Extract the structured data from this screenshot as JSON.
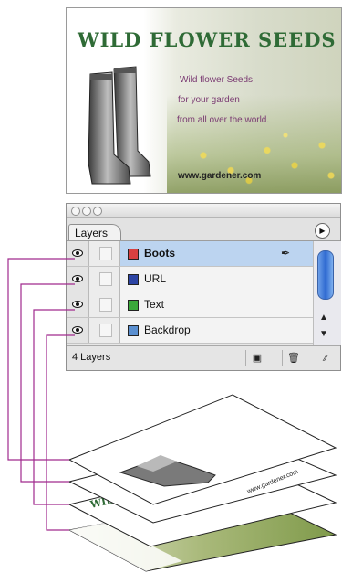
{
  "postcard": {
    "title": "WILD FLOWER SEEDS",
    "tagline": [
      "Wild flower Seeds",
      "for your garden",
      "from all over the world."
    ],
    "url": "www.gardener.com"
  },
  "panel": {
    "tab_label": "Layers",
    "menu_icon": "right-arrow-icon",
    "layers": [
      {
        "name": "Boots",
        "color": "#d84040",
        "selected": true
      },
      {
        "name": "URL",
        "color": "#2c44a4",
        "selected": false
      },
      {
        "name": "Text",
        "color": "#3aa83a",
        "selected": false
      },
      {
        "name": "Backdrop",
        "color": "#5a8fd0",
        "selected": false
      }
    ],
    "layer_count": "4 Layers",
    "scroll_up_icon": "▲",
    "scroll_down_icon": "▼",
    "new_layer_icon": "new-layer-icon",
    "trash_icon": "trash-icon"
  },
  "stack": {
    "url_text": "www.gardener.com",
    "title_fragment": "WILD"
  },
  "colors": {
    "connector": "#a02a8e",
    "title_green": "#2f6b36",
    "tagline_purple": "#7a3a72",
    "selection": "#bcd4f0"
  }
}
